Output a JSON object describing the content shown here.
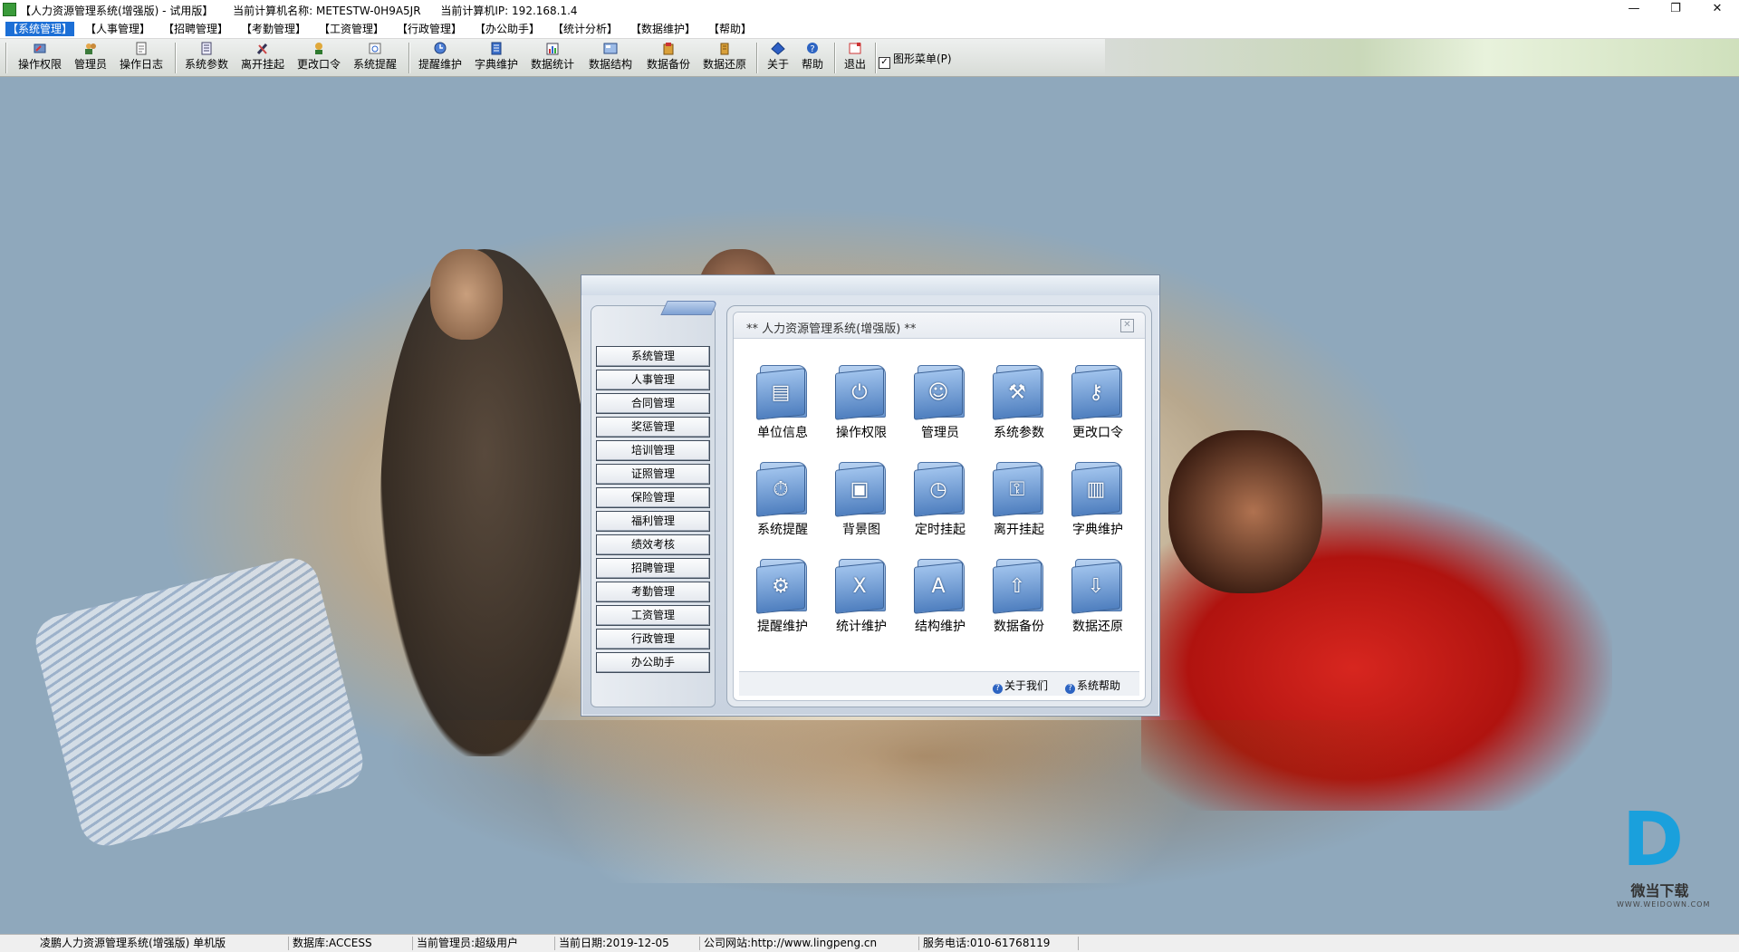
{
  "window": {
    "title": "【人力资源管理系统(增强版) - 试用版】",
    "computer_name_label": "当前计算机名称:",
    "computer_name": "METESTW-0H9A5JR",
    "ip_label": "当前计算机IP:",
    "ip": "192.168.1.4",
    "minimize": "—",
    "restore": "❐",
    "close": "✕"
  },
  "menu": [
    {
      "label": "【系统管理】",
      "active": true
    },
    {
      "label": "【人事管理】"
    },
    {
      "label": "【招聘管理】"
    },
    {
      "label": "【考勤管理】"
    },
    {
      "label": "【工资管理】"
    },
    {
      "label": "【行政管理】"
    },
    {
      "label": "【办公助手】"
    },
    {
      "label": "【统计分析】"
    },
    {
      "label": "【数据维护】"
    },
    {
      "label": "【帮助】"
    }
  ],
  "toolbar": {
    "items": [
      {
        "label": "操作权限",
        "icon": "key-icon"
      },
      {
        "label": "管理员",
        "icon": "users-icon"
      },
      {
        "label": "操作日志",
        "icon": "log-icon"
      },
      {
        "label": "系统参数",
        "icon": "settings-icon"
      },
      {
        "label": "离开挂起",
        "icon": "tools-icon"
      },
      {
        "label": "更改口令",
        "icon": "password-icon"
      },
      {
        "label": "系统提醒",
        "icon": "reminder-icon"
      },
      {
        "label": "提醒维护",
        "icon": "reminder-edit-icon"
      },
      {
        "label": "字典维护",
        "icon": "dictionary-icon"
      },
      {
        "label": "数据统计",
        "icon": "stats-icon"
      },
      {
        "label": "数据结构",
        "icon": "structure-icon"
      },
      {
        "label": "数据备份",
        "icon": "backup-icon"
      },
      {
        "label": "数据还原",
        "icon": "restore-icon"
      },
      {
        "label": "关于",
        "icon": "about-icon"
      },
      {
        "label": "帮助",
        "icon": "help-icon"
      },
      {
        "label": "退出",
        "icon": "exit-icon"
      }
    ],
    "graphic_menu_label": "图形菜单(P)",
    "graphic_menu_checked": true
  },
  "dialog": {
    "side_menu": [
      "系统管理",
      "人事管理",
      "合同管理",
      "奖惩管理",
      "培训管理",
      "证照管理",
      "保险管理",
      "福利管理",
      "绩效考核",
      "招聘管理",
      "考勤管理",
      "工资管理",
      "行政管理",
      "办公助手"
    ],
    "panel_title": "**  人力资源管理系统(增强版)  **",
    "grid": [
      {
        "label": "单位信息",
        "icon": "unit-info-icon",
        "glyph": "▤"
      },
      {
        "label": "操作权限",
        "icon": "power-icon",
        "glyph": "⏻"
      },
      {
        "label": "管理员",
        "icon": "admin-users-icon",
        "glyph": "☺"
      },
      {
        "label": "系统参数",
        "icon": "tools-icon",
        "glyph": "⚒"
      },
      {
        "label": "更改口令",
        "icon": "keys-icon",
        "glyph": "⚷"
      },
      {
        "label": "系统提醒",
        "icon": "stopwatch-icon",
        "glyph": "⏱"
      },
      {
        "label": "背景图",
        "icon": "picture-icon",
        "glyph": "▣"
      },
      {
        "label": "定时挂起",
        "icon": "clock-icon",
        "glyph": "◷"
      },
      {
        "label": "离开挂起",
        "icon": "lock-icon",
        "glyph": "⚿"
      },
      {
        "label": "字典维护",
        "icon": "books-icon",
        "glyph": "▥"
      },
      {
        "label": "提醒维护",
        "icon": "gear-icon",
        "glyph": "⚙"
      },
      {
        "label": "统计维护",
        "icon": "excel-icon",
        "glyph": "X"
      },
      {
        "label": "结构维护",
        "icon": "structure-a-icon",
        "glyph": "A"
      },
      {
        "label": "数据备份",
        "icon": "arrow-up-icon",
        "glyph": "⇧"
      },
      {
        "label": "数据还原",
        "icon": "arrow-down-icon",
        "glyph": "⇩"
      }
    ],
    "footer": {
      "about": "关于我们",
      "help": "系统帮助"
    }
  },
  "watermark": {
    "title": "微当下载",
    "url": "WWW.WEIDOWN.COM"
  },
  "status": {
    "app": "凌鹏人力资源管理系统(增强版) 单机版",
    "db": "数据库:ACCESS",
    "admin": "当前管理员:超级用户",
    "date": "当前日期:2019-12-05",
    "site": "公司网站:http://www.lingpeng.cn",
    "phone": "服务电话:010-61768119"
  },
  "colors": {
    "menu_active": "#1c6fd6",
    "desktop": "#8fa8bc",
    "folder": "#6c97cf"
  }
}
